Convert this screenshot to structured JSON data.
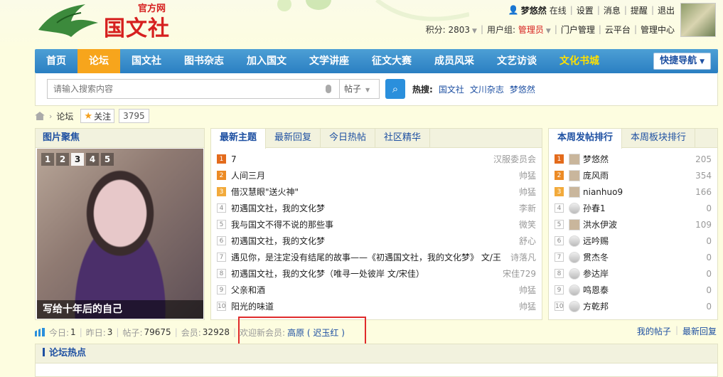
{
  "logo": {
    "sub": "官方网",
    "main": "国文社"
  },
  "user": {
    "name": "梦悠然",
    "status": "在线",
    "links": [
      "设置",
      "消息",
      "提醒",
      "退出"
    ],
    "score_label": "积分: 2803",
    "group_label": "用户组:",
    "group_value": "管理员",
    "links2": [
      "门户管理",
      "云平台",
      "管理中心"
    ]
  },
  "nav": {
    "items": [
      "首页",
      "论坛",
      "国文社",
      "图书杂志",
      "加入国文",
      "文学讲座",
      "征文大赛",
      "成员风采",
      "文艺访谈",
      "文化书城"
    ],
    "active_index": 1,
    "quick_label": "快捷导航"
  },
  "search": {
    "placeholder": "请输入搜索内容",
    "type": "帖子",
    "hot_label": "热搜:",
    "hot_items": [
      "国文社",
      "文川杂志",
      "梦悠然"
    ]
  },
  "breadcrumb": {
    "current": "论坛",
    "follow_label": "关注",
    "follow_count": "3795"
  },
  "photo_panel": {
    "title": "图片聚焦",
    "pages": [
      "1",
      "2",
      "3",
      "4",
      "5"
    ],
    "active_page": 2,
    "caption": "写给十年后的自己"
  },
  "thread_panel": {
    "tabs": [
      "最新主题",
      "最新回复",
      "今日热帖",
      "社区精华"
    ],
    "active_tab": 0,
    "rows": [
      {
        "n": "1",
        "title": "7",
        "author": "汉服委员会"
      },
      {
        "n": "2",
        "title": "人间三月",
        "author": "帅猛"
      },
      {
        "n": "3",
        "title": "借汉慧眼\"送火神\"",
        "author": "帅猛"
      },
      {
        "n": "4",
        "title": "初遇国文社，我的文化梦",
        "author": "李新"
      },
      {
        "n": "5",
        "title": "我与国文不得不说的那些事",
        "author": "微笑"
      },
      {
        "n": "6",
        "title": "初遇国文社，我的文化梦",
        "author": "舒心"
      },
      {
        "n": "7",
        "title": "遇见你，是注定没有结尾的故事——《初遇国文社，我的文化梦》 文/王",
        "author": "诗落凡"
      },
      {
        "n": "8",
        "title": "初遇国文社，我的文化梦（唯寻一处彼岸 文/宋佳）",
        "author": "宋佳729"
      },
      {
        "n": "9",
        "title": "父亲和酒",
        "author": "帅猛"
      },
      {
        "n": "10",
        "title": "阳光的味道",
        "author": "帅猛"
      }
    ]
  },
  "rank_panel": {
    "tabs": [
      "本周发帖排行",
      "本周板块排行"
    ],
    "active_tab": 0,
    "rows": [
      {
        "n": "1",
        "name": "梦悠然",
        "count": "205"
      },
      {
        "n": "2",
        "name": "庞风雨",
        "count": "354"
      },
      {
        "n": "3",
        "name": "nianhuo9",
        "count": "166"
      },
      {
        "n": "4",
        "name": "孙春1",
        "count": "0"
      },
      {
        "n": "5",
        "name": "洪水伊波",
        "count": "109"
      },
      {
        "n": "6",
        "name": "远吟赐",
        "count": "0"
      },
      {
        "n": "7",
        "name": "贯杰冬",
        "count": "0"
      },
      {
        "n": "8",
        "name": "参达岸",
        "count": "0"
      },
      {
        "n": "9",
        "name": "鸣恩泰",
        "count": "0"
      },
      {
        "n": "10",
        "name": "方乾邦",
        "count": "0"
      }
    ]
  },
  "stats": {
    "today_label": "今日:",
    "today": "1",
    "yesterday_label": "昨日:",
    "yesterday": "3",
    "posts_label": "帖子:",
    "posts": "79675",
    "members_label": "会员:",
    "members": "32928",
    "welcome_label": "欢迎新会员:",
    "welcome_names": "高原 ( 迟玉红 )",
    "my_posts": "我的帖子",
    "latest_reply": "最新回复"
  },
  "forum_hot": {
    "title": "论坛热点"
  },
  "colors": {
    "nav": "#2a7fc2",
    "active": "#f7a51c",
    "accent_red": "#e02b2b",
    "link": "#1e50a2"
  }
}
